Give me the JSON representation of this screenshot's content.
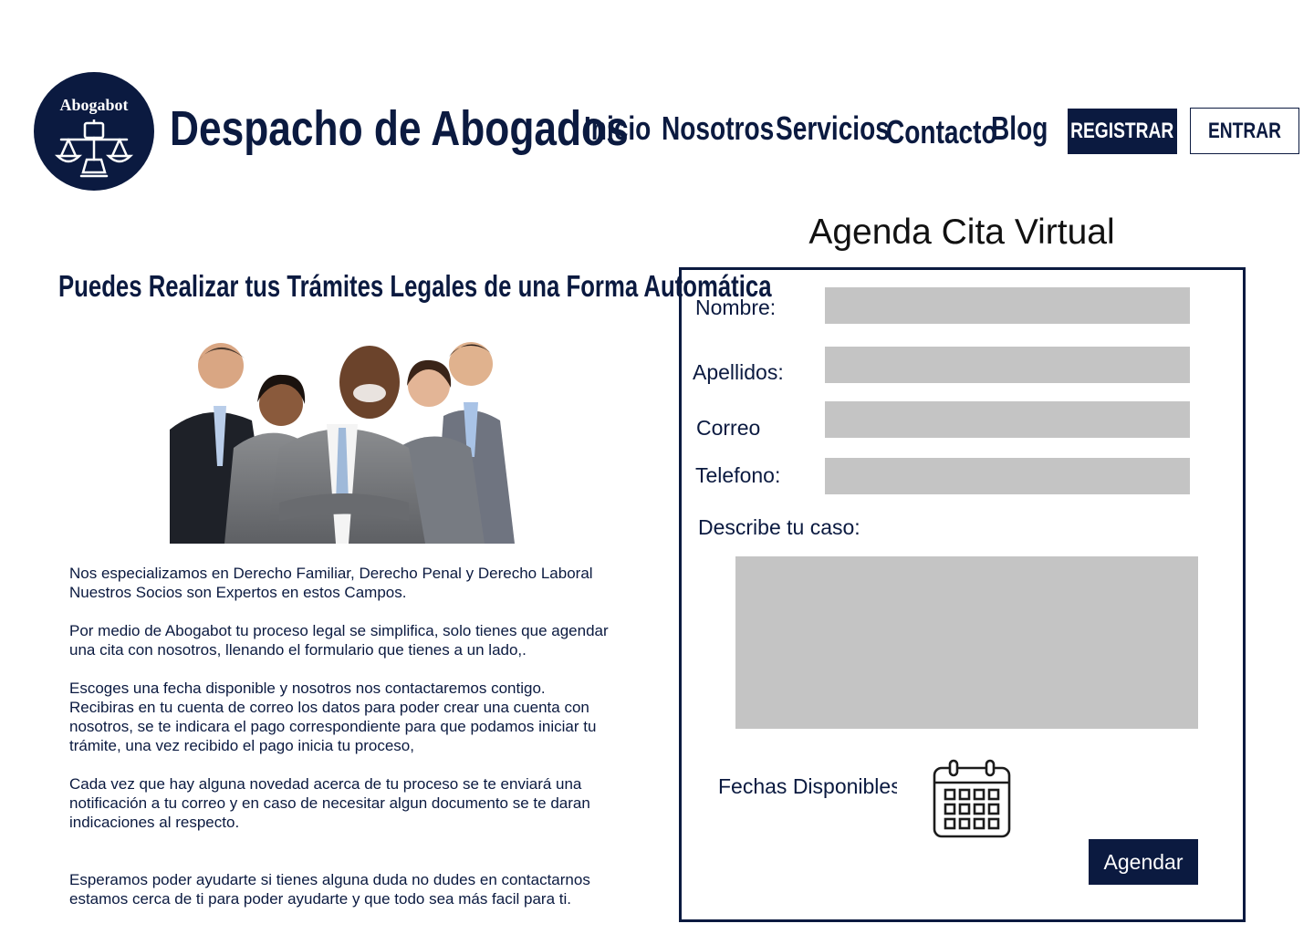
{
  "brand": {
    "logo_text": "Abogabot",
    "site_title": "Despacho de Abogados"
  },
  "nav": {
    "items": [
      "Inicio",
      "Nosotros",
      "Servicios",
      "Contacto",
      "Blog"
    ],
    "register_label": "REGISTRAR",
    "login_label": "ENTRAR"
  },
  "left": {
    "heading": "Puedes Realizar tus Trámites Legales de una Forma Automática",
    "paragraphs": [
      [
        "Nos especializamos en Derecho Familiar, Derecho Penal y Derecho Laboral",
        "Nuestros Socios son Expertos en estos Campos."
      ],
      [
        "Por medio de Abogabot tu proceso legal se simplifica, solo tienes que agendar",
        "una cita con nosotros, llenando el formulario que tienes a un lado,."
      ],
      [
        "Escoges una fecha disponible y nosotros nos contactaremos contigo.",
        "Recibiras en tu cuenta de correo los datos para poder crear una cuenta con",
        "nosotros, se te indicara el pago correspondiente para que podamos iniciar tu",
        "trámite, una vez recibido el pago inicia tu proceso,"
      ],
      [
        "Cada vez que hay alguna novedad acerca de tu proceso se te enviará una",
        "notificación a tu correo y en caso de necesitar algun documento se te daran",
        "indicaciones al respecto."
      ],
      [
        "Esperamos poder ayudarte si tienes alguna duda no dudes en contactarnos",
        "estamos cerca de ti para poder ayudarte y que todo sea más facil para ti."
      ]
    ]
  },
  "form": {
    "title": "Agenda Cita Virtual",
    "nombre_label": "Nombre:",
    "nombre_value": "",
    "apellidos_label": "Apellidos:",
    "apellidos_value": "",
    "correo_label": "Correo",
    "correo_value": "",
    "telefono_label": "Telefono:",
    "telefono_value": "",
    "caso_label": "Describe tu caso:",
    "caso_value": "",
    "fechas_label": "Fechas Disponibles",
    "calendar_icon": "calendar-icon",
    "submit_label": "Agendar"
  },
  "colors": {
    "primary": "#0b1a40",
    "field_bg": "#c4c4c4",
    "background": "#ffffff"
  }
}
